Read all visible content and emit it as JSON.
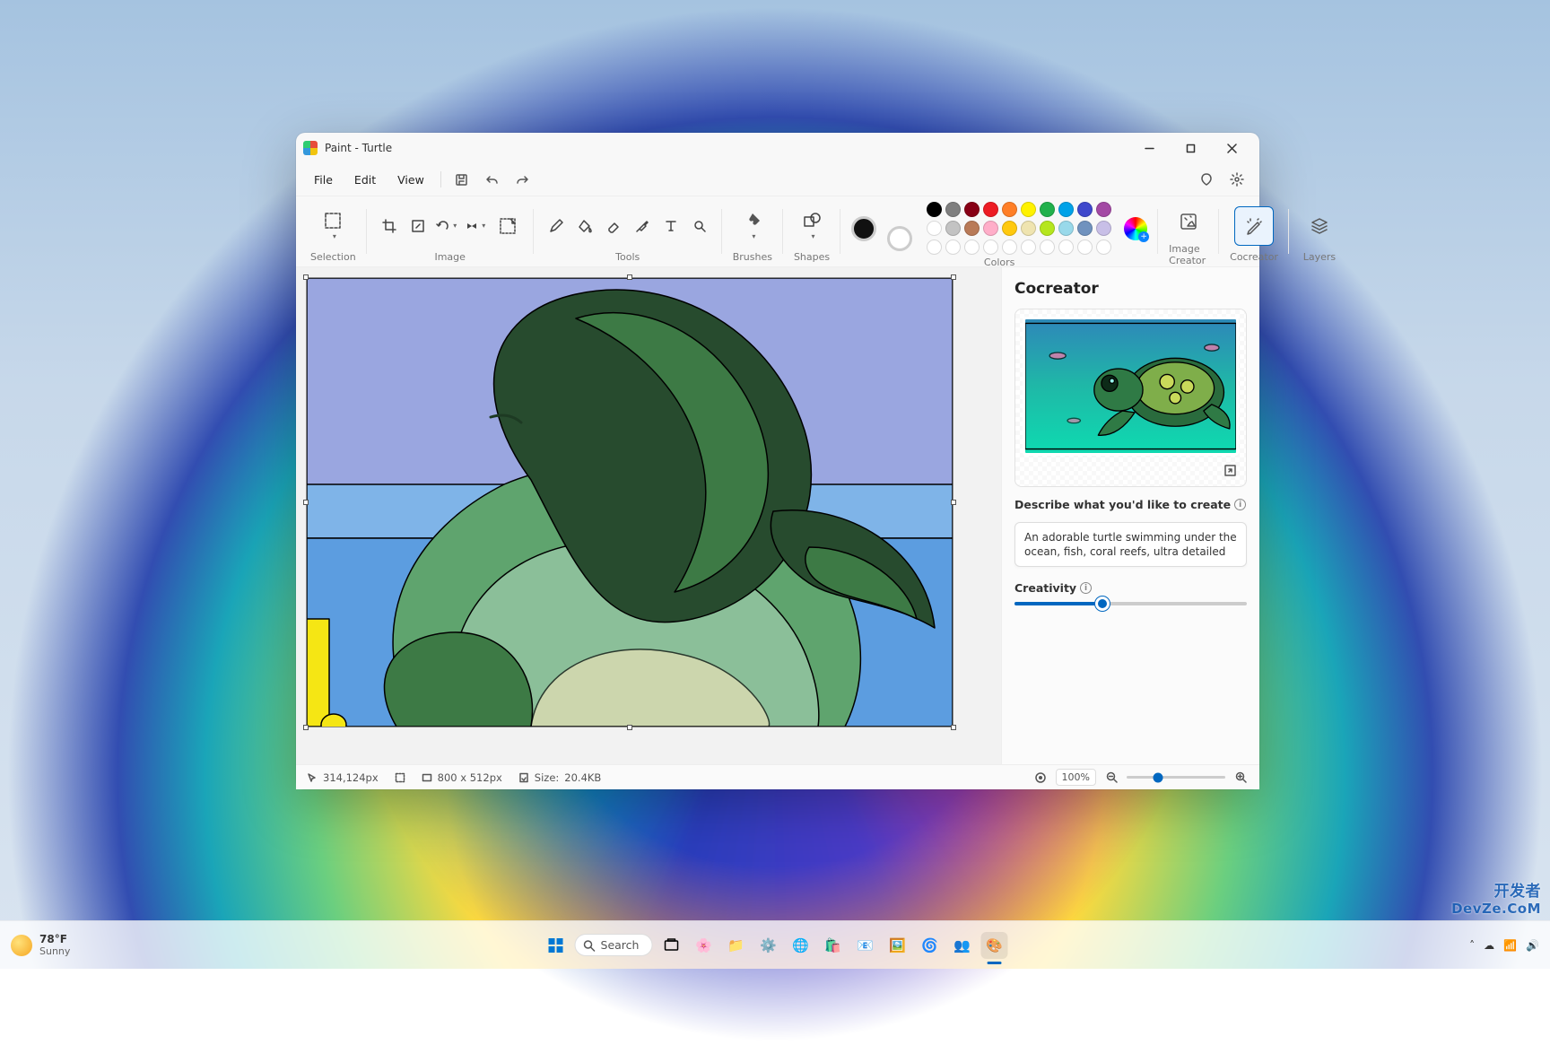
{
  "window": {
    "title": "Paint - Turtle"
  },
  "menubar": {
    "file": "File",
    "edit": "Edit",
    "view": "View"
  },
  "ribbon": {
    "selection": "Selection",
    "image": "Image",
    "tools": "Tools",
    "brushes": "Brushes",
    "shapes": "Shapes",
    "colors": "Colors",
    "image_creator": "Image Creator",
    "cocreator": "Cocreator",
    "layers": "Layers"
  },
  "palette": {
    "row1": [
      "#000000",
      "#7f7f7f",
      "#880015",
      "#ed1c24",
      "#ff7f27",
      "#fff200",
      "#22b14c",
      "#00a2e8",
      "#3f48cc",
      "#a349a4"
    ],
    "row2": [
      "#ffffff",
      "#c3c3c3",
      "#b97a57",
      "#ffaec9",
      "#ffc90e",
      "#efe4b0",
      "#b5e61d",
      "#99d9ea",
      "#7092be",
      "#c8bfe7"
    ]
  },
  "cocreator": {
    "title": "Cocreator",
    "describe_label": "Describe what you'd like to create",
    "prompt": "An adorable turtle swimming under the ocean, fish, coral reefs, ultra detailed",
    "creativity_label": "Creativity"
  },
  "status": {
    "cursor": "314,124px",
    "dims": "800  x  512px",
    "size_label": "Size:",
    "size": "20.4KB",
    "zoom": "100%"
  },
  "taskbar": {
    "temp": "78°F",
    "weather": "Sunny",
    "search": "Search"
  },
  "watermark": {
    "cn": "开发者",
    "en": "DevZe.CoM"
  }
}
